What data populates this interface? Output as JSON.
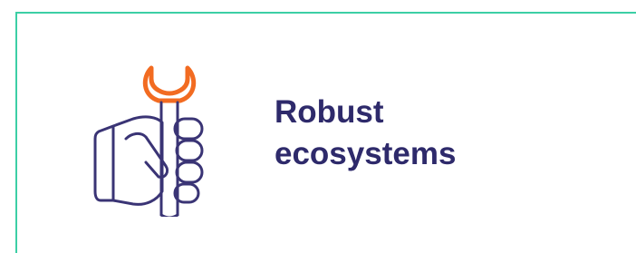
{
  "feature": {
    "title_line1": "Robust",
    "title_line2": "ecosystems",
    "icon": "hand-holding-wrench-icon"
  },
  "colors": {
    "border": "#3ccfa5",
    "title": "#2e2a6b",
    "icon_outline": "#3a3475",
    "icon_accent": "#f26b21"
  }
}
